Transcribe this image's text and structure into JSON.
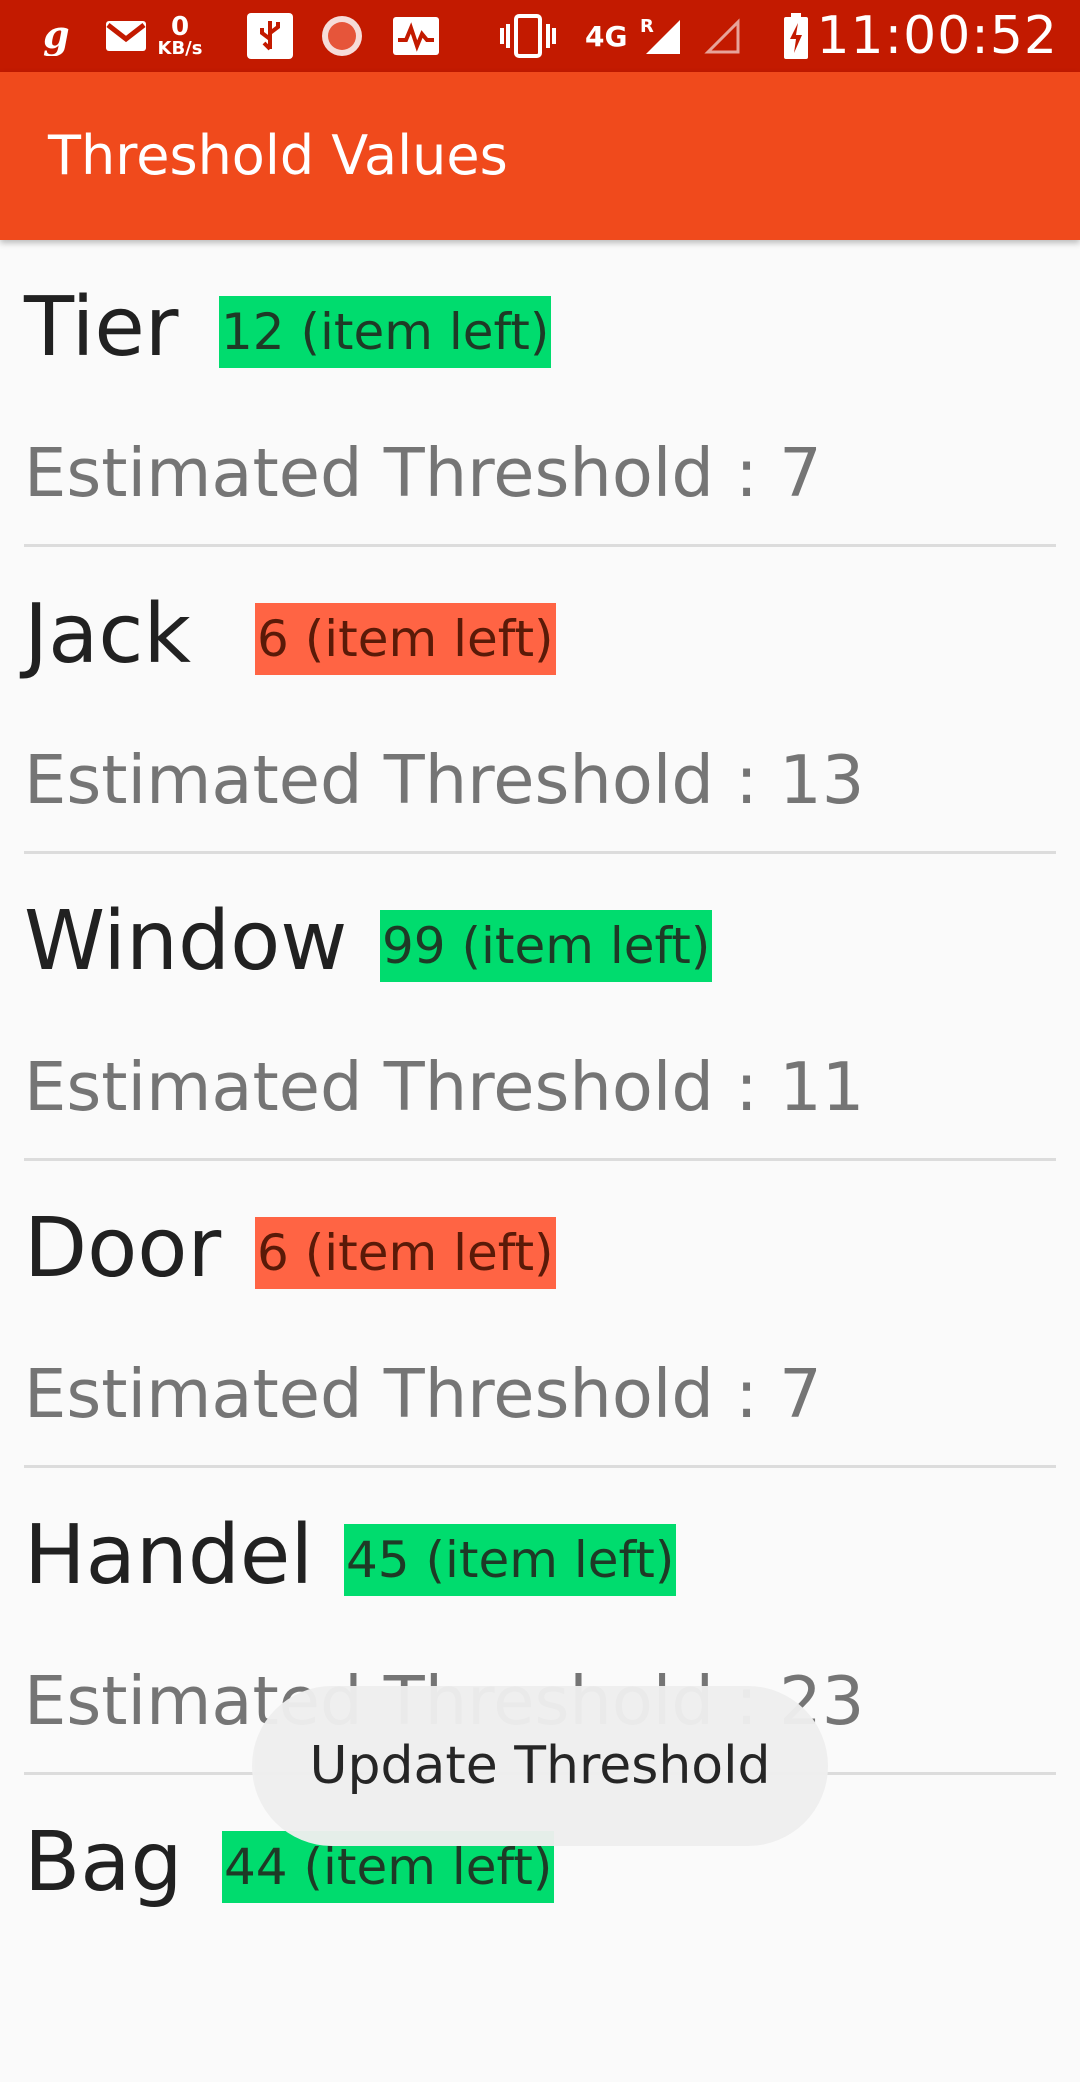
{
  "status_bar": {
    "time": "11:00:52",
    "network_speed_value": "0",
    "network_speed_unit": "KB/s",
    "network_type": "4G",
    "roaming": "R",
    "icons": [
      "glance-icon",
      "gmail-icon",
      "usb-icon",
      "circle-app-icon",
      "activity-icon",
      "vibrate-icon",
      "signal-icon",
      "signal-empty-icon",
      "battery-charging-icon"
    ]
  },
  "app_bar": {
    "title": "Threshold Values"
  },
  "colors": {
    "status_bar": "#c31a00",
    "app_bar": "#f04a1c",
    "badge_ok": "#00dc6e",
    "badge_low": "#ff6444"
  },
  "items": [
    {
      "name": "Tier",
      "stock": "12 (item left)",
      "threshold": "Estimated Threshold : 7",
      "status": "ok"
    },
    {
      "name": "Jack",
      "stock": "6 (item left)",
      "threshold": "Estimated Threshold : 13",
      "status": "low"
    },
    {
      "name": "Window",
      "stock": "99 (item left)",
      "threshold": "Estimated Threshold : 11",
      "status": "ok"
    },
    {
      "name": "Door",
      "stock": "6 (item left)",
      "threshold": "Estimated Threshold : 7",
      "status": "low"
    },
    {
      "name": "Handel",
      "stock": "45 (item left)",
      "threshold": "Estimated Threshold : 23",
      "status": "ok"
    },
    {
      "name": "Bag",
      "stock": "44 (item left)",
      "threshold": "",
      "status": "ok"
    }
  ],
  "toast": {
    "message": "Update Threshold"
  }
}
